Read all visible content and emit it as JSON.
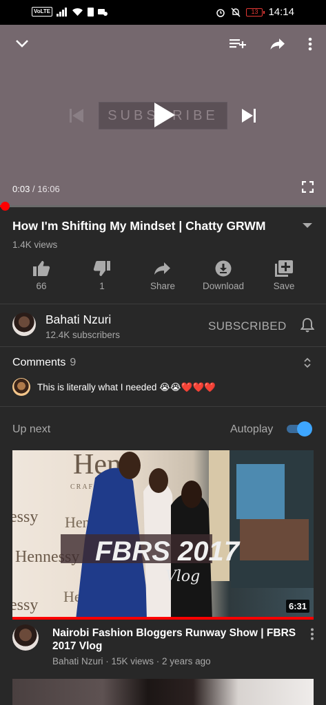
{
  "status_bar": {
    "volte": "VoLTE",
    "battery": "13",
    "time": "14:14"
  },
  "player": {
    "subscribe_card": "SUBSCRIBE",
    "current_time": "0:03",
    "separator": "/",
    "duration": "16:06",
    "progress_fraction": 0.003
  },
  "video": {
    "title": "How I'm Shifting My Mindset | Chatty GRWM",
    "views": "1.4K views"
  },
  "actions": {
    "like_count": "66",
    "dislike_count": "1",
    "share": "Share",
    "download": "Download",
    "save": "Save"
  },
  "channel": {
    "name": "Bahati Nzuri",
    "subscribers": "12.4K subscribers",
    "subscribe_state": "SUBSCRIBED"
  },
  "comments": {
    "header": "Comments",
    "count": "9",
    "top_comment": "This is literally what I needed",
    "top_comment_emoji": "😭😭❤️❤️❤️"
  },
  "up_next": {
    "label": "Up next",
    "autoplay_label": "Autoplay",
    "autoplay_on": true
  },
  "related": [
    {
      "title": "Nairobi Fashion Bloggers Runway Show | FBRS 2017 Vlog",
      "meta": "Bahati Nzuri · 15K views · 2 years ago",
      "duration": "6:31",
      "thumb_overlay_title": "FBRS 2017",
      "thumb_overlay_sub": "Vlog"
    }
  ]
}
